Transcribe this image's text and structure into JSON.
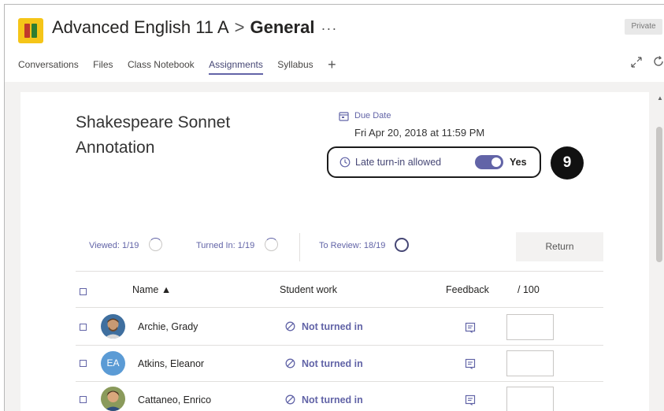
{
  "header": {
    "team_name": "Advanced English 11 A",
    "separator": ">",
    "channel": "General",
    "more": "···",
    "private_label": "Private",
    "icon": "team-book-icon"
  },
  "tabs": [
    {
      "label": "Conversations",
      "active": false
    },
    {
      "label": "Files",
      "active": false
    },
    {
      "label": "Class Notebook",
      "active": false
    },
    {
      "label": "Assignments",
      "active": true
    },
    {
      "label": "Syllabus",
      "active": false
    }
  ],
  "tab_add": "+",
  "assignment": {
    "title": "Shakespeare Sonnet Annotation",
    "due_label": "Due Date",
    "due_value": "Fri Apr 20, 2018 at 11:59 PM",
    "late_label": "Late turn-in allowed",
    "late_enabled": true,
    "late_value": "Yes",
    "step_badge": "9"
  },
  "stats": {
    "viewed": "Viewed: 1/19",
    "turned_in": "Turned In: 1/19",
    "to_review": "To Review: 18/19",
    "return_label": "Return"
  },
  "table": {
    "headers": {
      "name": "Name ▲",
      "student_work": "Student work",
      "feedback": "Feedback",
      "points": "/ 100"
    },
    "rows": [
      {
        "name": "Archie, Grady",
        "avatar": "photo",
        "status": "Not turned in"
      },
      {
        "name": "Atkins, Eleanor",
        "avatar": "initials",
        "initials": "EA",
        "status": "Not turned in"
      },
      {
        "name": "Cattaneo, Enrico",
        "avatar": "photo",
        "status": "Not turned in"
      }
    ]
  },
  "colors": {
    "accent": "#6264a7",
    "team_icon": "#f5c518",
    "background": "#f3f2f1"
  }
}
